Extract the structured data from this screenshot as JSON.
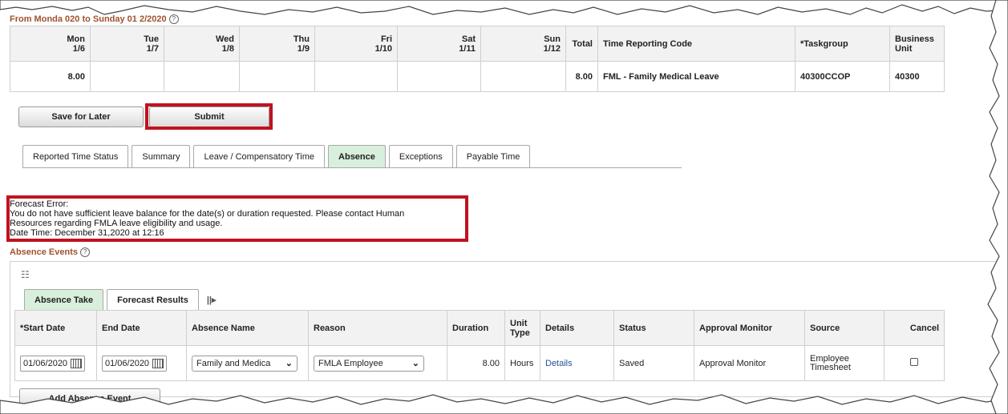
{
  "period_title": "From Monda  020 to Sunday 01  2/2020",
  "timesheet": {
    "days": [
      {
        "day": "Mon",
        "date": "1/6",
        "hours": "8.00"
      },
      {
        "day": "Tue",
        "date": "1/7",
        "hours": ""
      },
      {
        "day": "Wed",
        "date": "1/8",
        "hours": ""
      },
      {
        "day": "Thu",
        "date": "1/9",
        "hours": ""
      },
      {
        "day": "Fri",
        "date": "1/10",
        "hours": ""
      },
      {
        "day": "Sat",
        "date": "1/11",
        "hours": ""
      },
      {
        "day": "Sun",
        "date": "1/12",
        "hours": ""
      }
    ],
    "total_header": "Total",
    "trc_header": "Time Reporting Code",
    "taskgroup_header": "*Taskgroup",
    "bu_header_line1": "Business",
    "bu_header_line2": "Unit",
    "total": "8.00",
    "trc": "FML - Family Medical Leave",
    "taskgroup": "40300CCOP",
    "business_unit": "40300"
  },
  "buttons": {
    "save_for_later": "Save for Later",
    "submit": "Submit",
    "add_absence_event": "Add Absence Event"
  },
  "tabs": [
    {
      "label": "Reported Time Status",
      "active": false
    },
    {
      "label": "Summary",
      "active": false
    },
    {
      "label": "Leave / Compensatory Time",
      "active": false
    },
    {
      "label": "Absence",
      "active": true
    },
    {
      "label": "Exceptions",
      "active": false
    },
    {
      "label": "Payable Time",
      "active": false
    }
  ],
  "error": {
    "line1": "Forecast Error:",
    "line2": "You do not have sufficient leave balance for the date(s) or duration requested. Please contact Human",
    "line3": "Resources regarding FMLA leave eligibility and usage.",
    "line4": "Date Time: December 31,2020 at 12:16"
  },
  "absence_events": {
    "title": "Absence Events",
    "tabs": [
      "Absence Take",
      "Forecast Results"
    ],
    "show_all": "||▸",
    "headers": {
      "start_date": "*Start Date",
      "end_date": "End Date",
      "absence_name": "Absence Name",
      "reason": "Reason",
      "duration": "Duration",
      "unit_type_1": "Unit",
      "unit_type_2": "Type",
      "details": "Details",
      "status": "Status",
      "approval_monitor": "Approval Monitor",
      "source": "Source",
      "cancel": "Cancel"
    },
    "row": {
      "start_date": "01/06/2020",
      "end_date": "01/06/2020",
      "absence_name": "Family and Medica",
      "reason": "FMLA Employee",
      "duration": "8.00",
      "unit_type": "Hours",
      "details": "Details",
      "status": "Saved",
      "approval_monitor": "Approval Monitor",
      "source_line1": "Employee",
      "source_line2": "Timesheet"
    }
  },
  "colors": {
    "highlight_red": "#c1121f",
    "section_title": "#a0522d",
    "active_tab": "#d8efdc",
    "link": "#1f4fa0"
  }
}
